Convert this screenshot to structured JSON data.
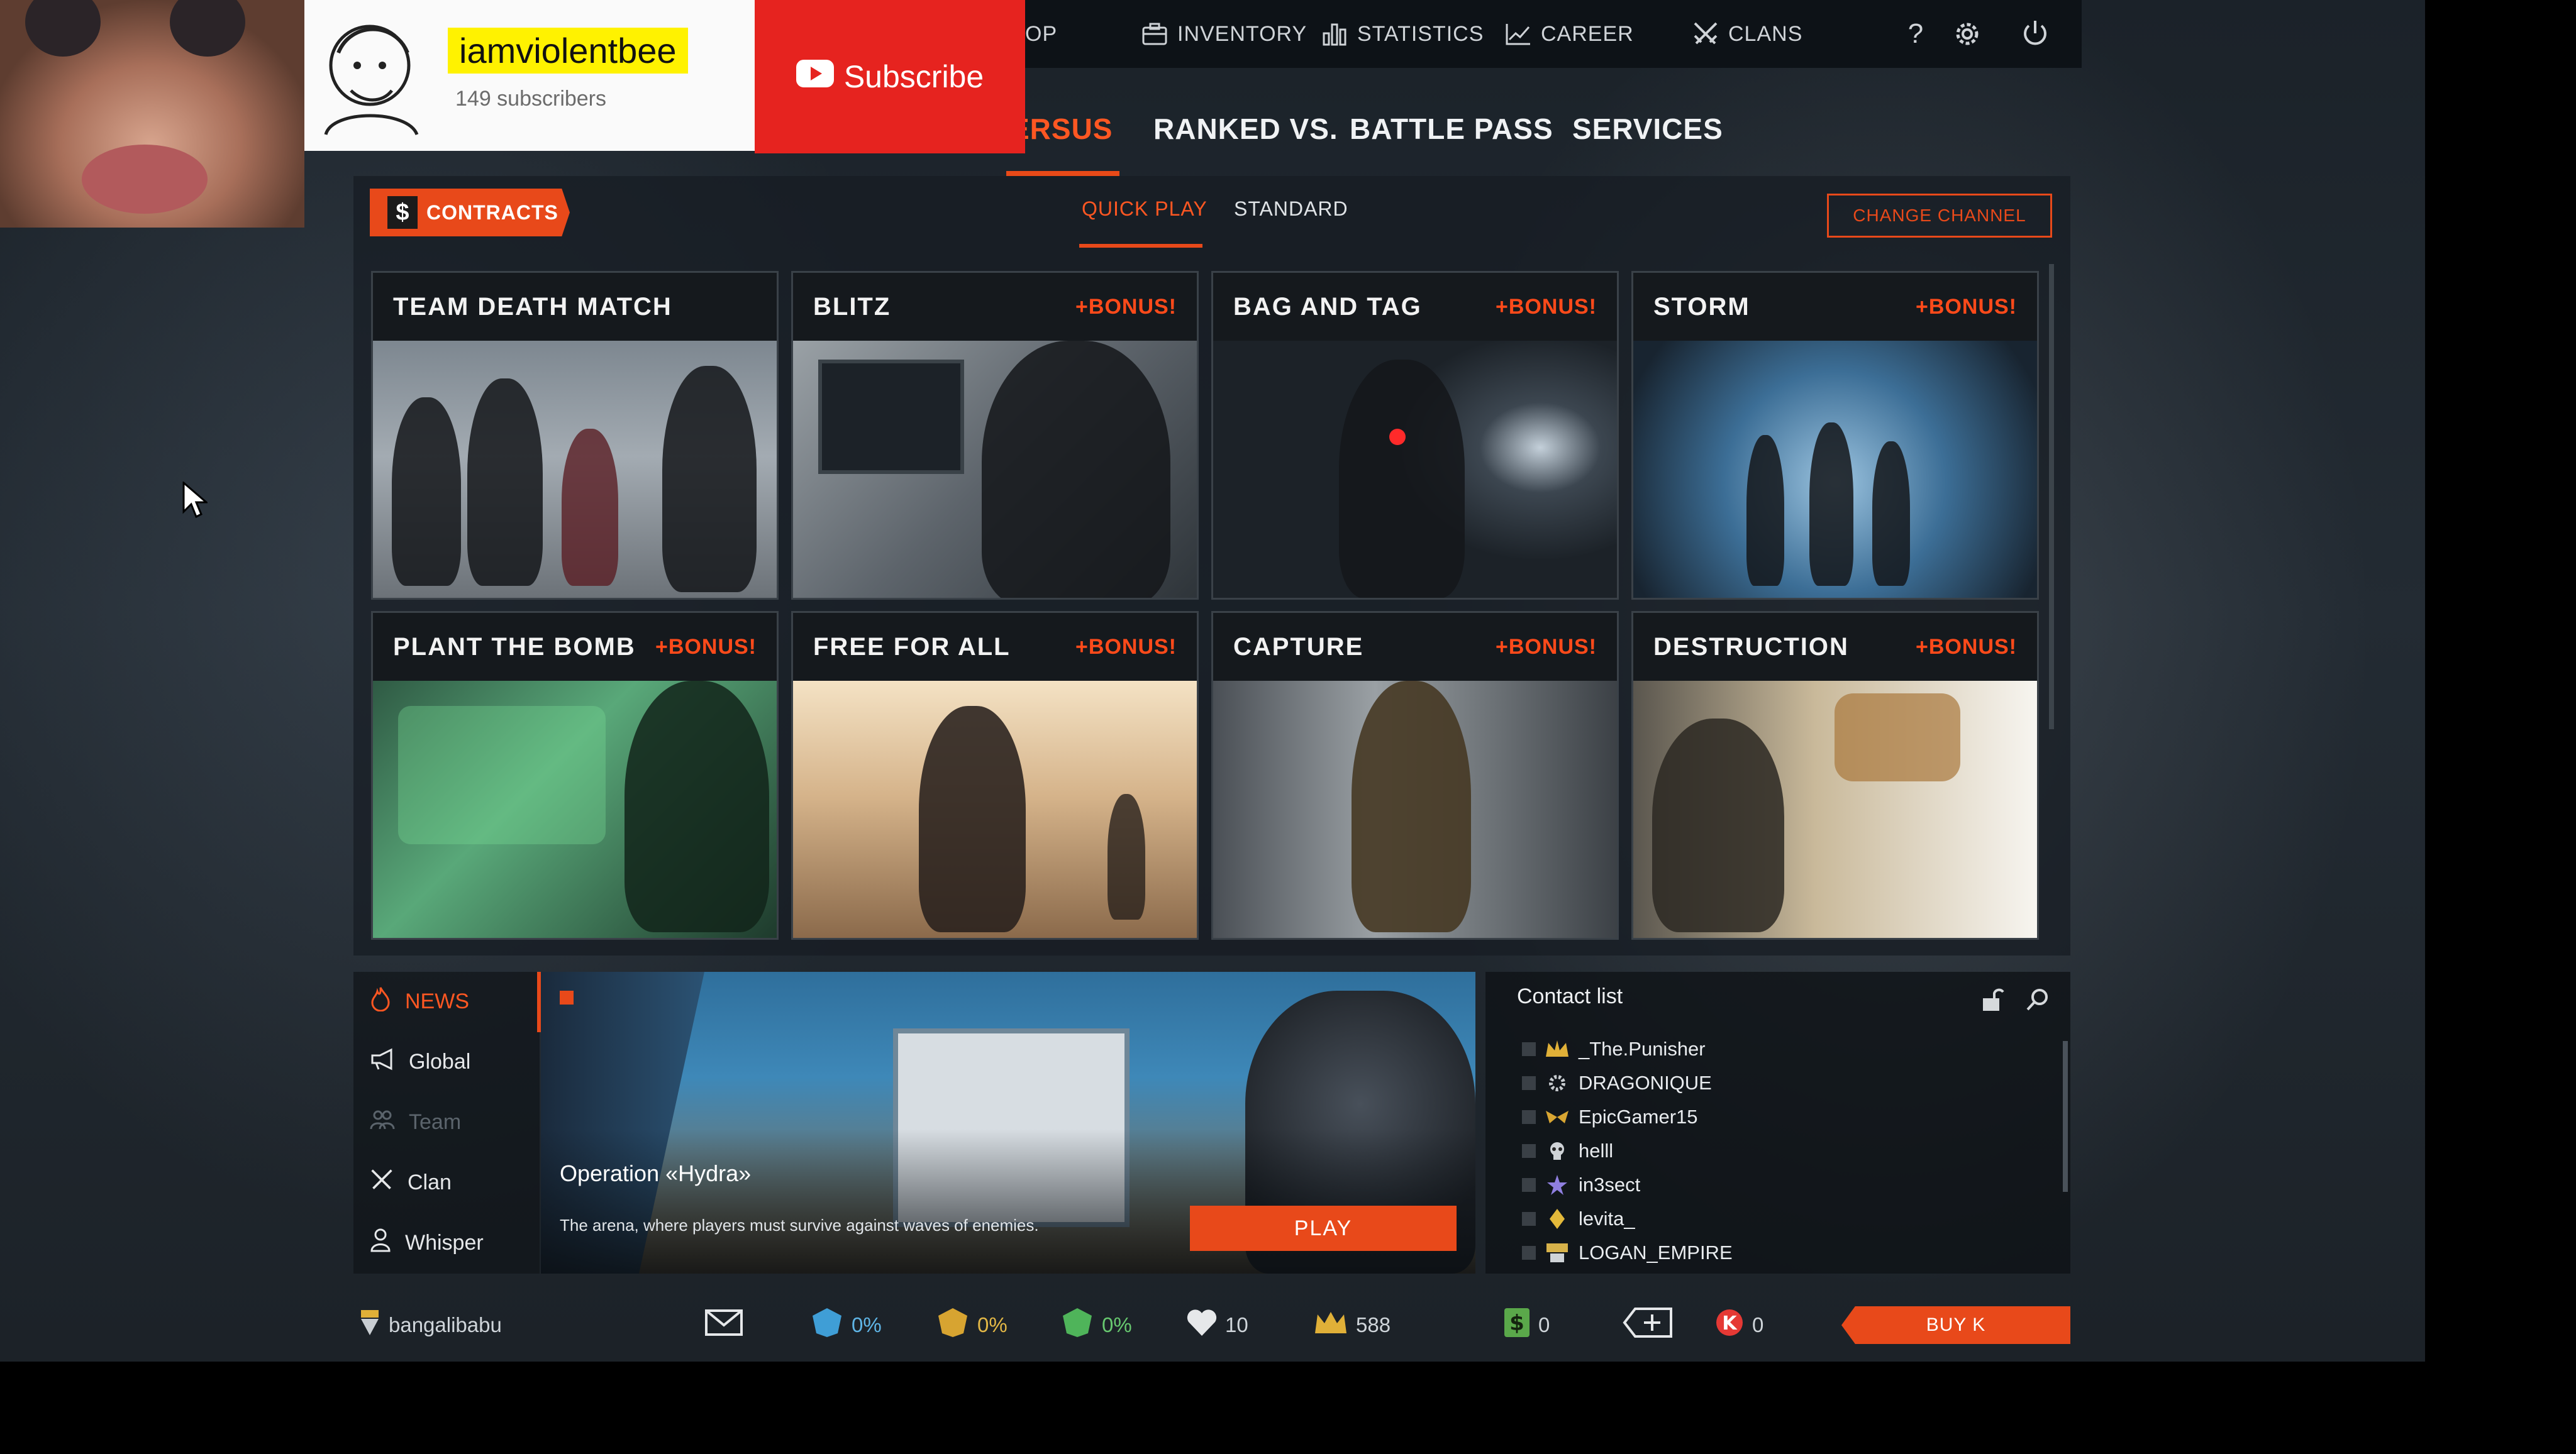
{
  "overlay": {
    "channel_name": "iamviolentbee",
    "subscribers": "149 subscribers",
    "subscribe_label": "Subscribe"
  },
  "topnav": {
    "shop_partial": "OP",
    "inventory": "INVENTORY",
    "statistics": "STATISTICS",
    "career": "CAREER",
    "clans": "CLANS",
    "help": "?"
  },
  "main_tabs": {
    "versus_partial": "ERSUS",
    "ranked": "RANKED VS.",
    "battle_pass": "BATTLE PASS",
    "services": "SERVICES"
  },
  "contracts": {
    "dollar": "$",
    "label": "CONTRACTS"
  },
  "subtabs": {
    "quick_play": "QUICK PLAY",
    "standard": "STANDARD"
  },
  "change_channel": "CHANGE CHANNEL",
  "modes": [
    {
      "title": "TEAM DEATH MATCH",
      "bonus": ""
    },
    {
      "title": "BLITZ",
      "bonus": "+BONUS!"
    },
    {
      "title": "BAG AND TAG",
      "bonus": "+BONUS!"
    },
    {
      "title": "STORM",
      "bonus": "+BONUS!"
    },
    {
      "title": "PLANT THE BOMB",
      "bonus": "+BONUS!"
    },
    {
      "title": "FREE FOR ALL",
      "bonus": "+BONUS!"
    },
    {
      "title": "CAPTURE",
      "bonus": "+BONUS!"
    },
    {
      "title": "DESTRUCTION",
      "bonus": "+BONUS!"
    }
  ],
  "news": {
    "items": [
      "NEWS",
      "Global",
      "Team",
      "Clan",
      "Whisper"
    ]
  },
  "banner": {
    "title": "Operation «Hydra»",
    "description": "The arena, where players must survive against waves of enemies.",
    "play_label": "PLAY"
  },
  "contacts": {
    "title": "Contact list",
    "list": [
      "_The.Punisher",
      "DRAGONIQUE",
      "EpicGamer15",
      "helll",
      "in3sect",
      "levita_",
      "LOGAN_EMPIRE"
    ]
  },
  "status": {
    "username": "bangalibabu",
    "blue_pct": "0%",
    "gold_pct": "0%",
    "green_pct": "0%",
    "hearts": "10",
    "crowns": "588",
    "cash": "0",
    "kcoins": "0",
    "buy_k": "BUY K"
  },
  "colors": {
    "accent": "#e8491a",
    "bonus": "#ff4a1a",
    "youtube_red": "#e6231f"
  }
}
